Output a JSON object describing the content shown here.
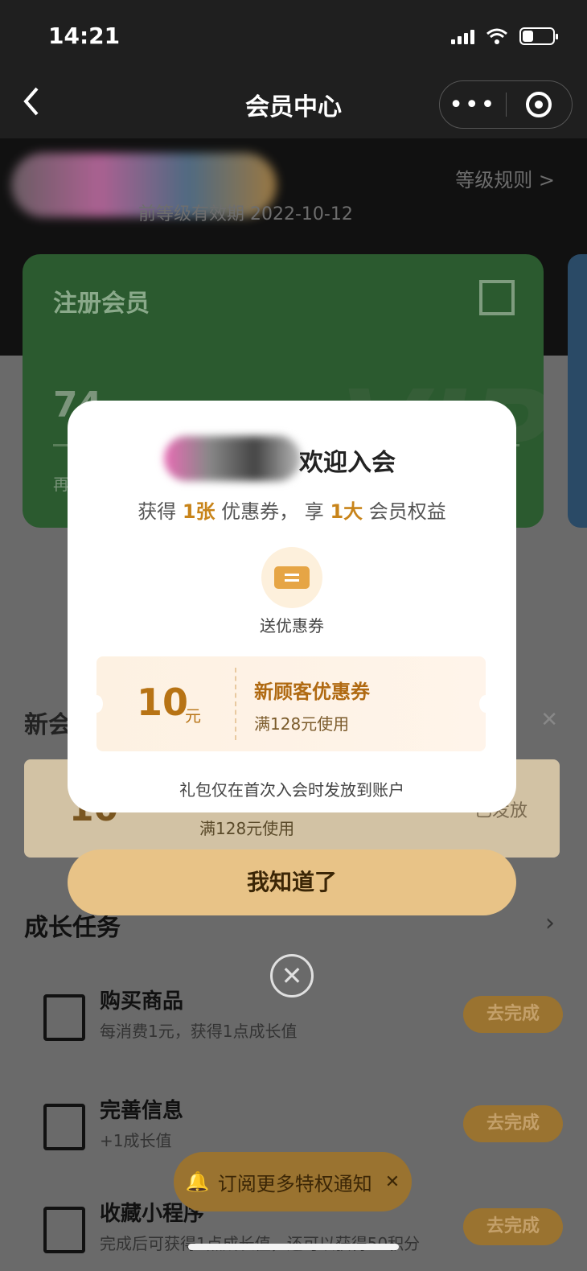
{
  "status_bar": {
    "time": "14:21",
    "battery_level": 0.35
  },
  "nav": {
    "back_icon": "chevron-left-icon",
    "title": "会员中心",
    "more_icon": "more-dots-icon",
    "mini_close_icon": "target-icon"
  },
  "header": {
    "level_rules": "等级规则 >",
    "validity": "前等级有效期 2022-10-12"
  },
  "card": {
    "title": "注册会员",
    "points": "74",
    "watermark": "VIP",
    "hint": "再"
  },
  "background": {
    "new_member_title": "新会",
    "coupon_amount": "10",
    "coupon_unit": "元",
    "coupon_condition": "满128元使用",
    "coupon_status": "已发放",
    "growth_title": "成长任务",
    "tasks": [
      {
        "name": "购买商品",
        "desc": "每消费1元，获得1点成长值",
        "button": "去完成"
      },
      {
        "name": "完善信息",
        "desc": "+1成长值",
        "button": "去完成"
      },
      {
        "name": "收藏小程序",
        "desc": "完成后可获得1点成长值，还可以获得50积分",
        "button": "去完成"
      }
    ],
    "subscribe": "订阅更多特权通知"
  },
  "modal": {
    "welcome": "欢迎入会",
    "subtitle_prefix": "获得",
    "subtitle_count1": "1张",
    "subtitle_mid": "优惠券，  享",
    "subtitle_count2": "1大",
    "subtitle_suffix": "会员权益",
    "gift_label": "送优惠券",
    "coupon": {
      "amount": "10",
      "unit": "元",
      "name": "新顾客优惠券",
      "condition": "满128元使用"
    },
    "footnote": "礼包仅在首次入会时发放到账户",
    "ok_button": "我知道了"
  }
}
